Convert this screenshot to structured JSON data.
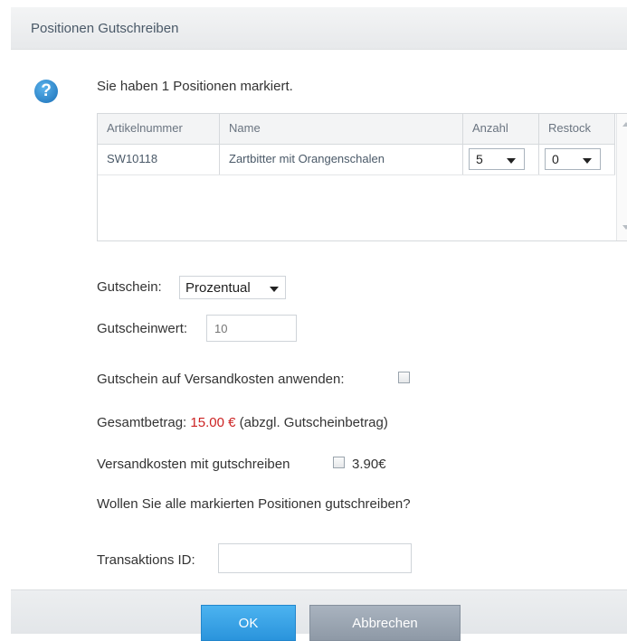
{
  "window": {
    "title": "Positionen Gutschreiben"
  },
  "message": "Sie haben 1 Positionen markiert.",
  "grid": {
    "columns": [
      "Artikelnummer",
      "Name",
      "Anzahl",
      "Restock"
    ],
    "rows": [
      {
        "sku": "SW10118",
        "name": "Zartbitter mit Orangenschalen",
        "quantity": "5",
        "restock": "0"
      }
    ]
  },
  "voucher": {
    "label": "Gutschein:",
    "type_selected": "Prozentual",
    "value_label": "Gutscheinwert:",
    "value_placeholder": "10",
    "apply_shipping_label": "Gutschein auf Versandkosten anwenden:"
  },
  "total": {
    "label": "Gesamtbetrag:",
    "amount": "15.00 €",
    "note": "(abzgl. Gutscheinbetrag)"
  },
  "shipping": {
    "label": "Versandkosten mit gutschreiben",
    "amount": "3.90€"
  },
  "confirm_question": "Wollen Sie alle markierten Positionen gutschreiben?",
  "transaction": {
    "label": "Transaktions ID:",
    "value": ""
  },
  "buttons": {
    "ok": "OK",
    "cancel": "Abbrechen"
  },
  "colors": {
    "accent": "#2a94dc",
    "total_amount": "#cc2222",
    "cancel": "#8e99a6"
  }
}
